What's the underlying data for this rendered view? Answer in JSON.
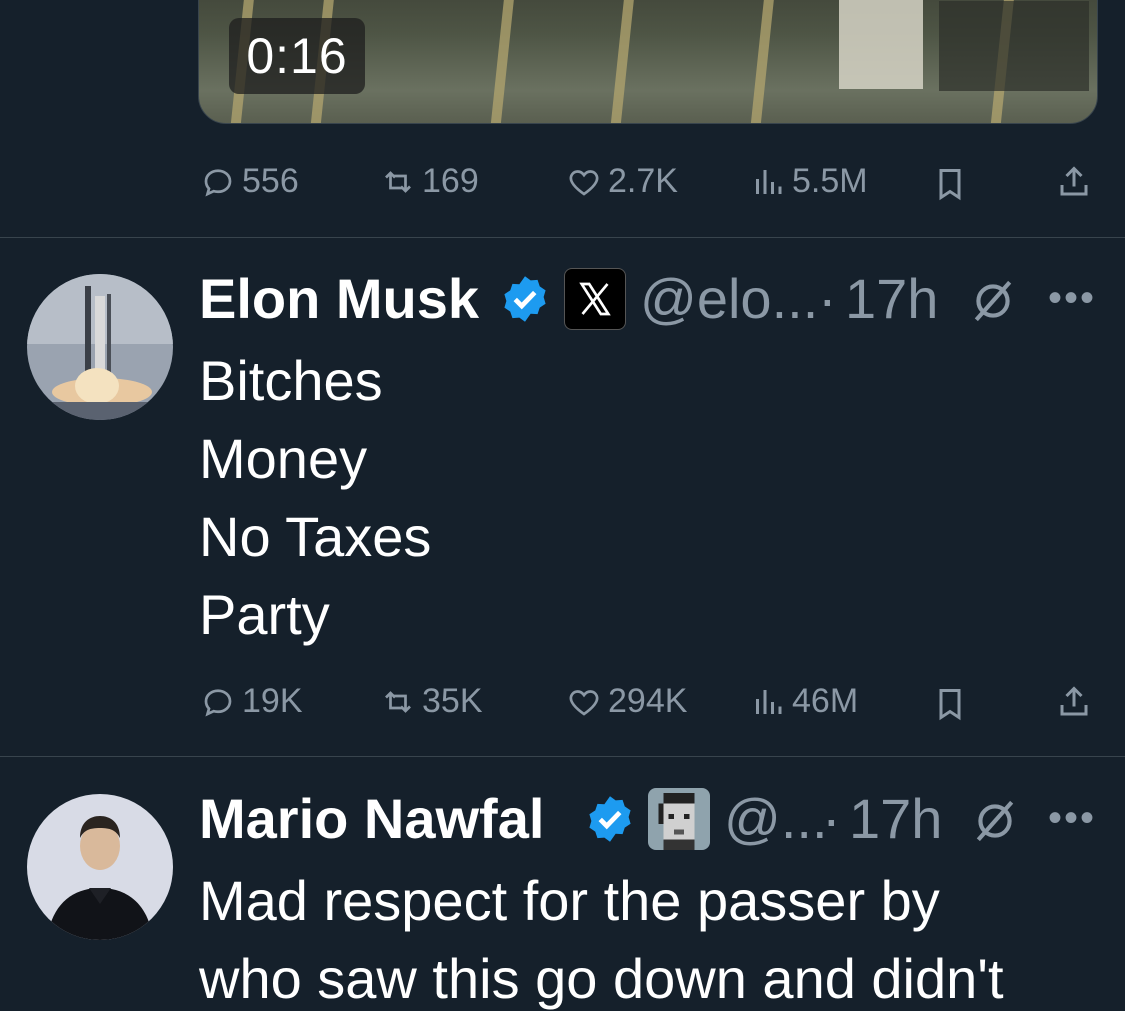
{
  "video": {
    "duration": "0:16"
  },
  "tweet1_stats": {
    "replies": "556",
    "retweets": "169",
    "likes": "2.7K",
    "views": "5.5M"
  },
  "tweet2": {
    "name": "Elon Musk",
    "handle": "@elo...",
    "dot": "·",
    "time": "17h",
    "lines": [
      "Bitches",
      "Money",
      "No Taxes",
      "Party"
    ],
    "stats": {
      "replies": "19K",
      "retweets": "35K",
      "likes": "294K",
      "views": "46M"
    }
  },
  "tweet3": {
    "name": "Mario Nawfal",
    "handle": "@...",
    "dot": "·",
    "time": "17h",
    "lines": [
      "Mad respect for the passer by",
      "who saw this go down and didn't"
    ]
  },
  "colors": {
    "background": "#15202b",
    "muted": "#8b98a5",
    "verified": "#1d9bf0",
    "divider": "#38444d"
  }
}
